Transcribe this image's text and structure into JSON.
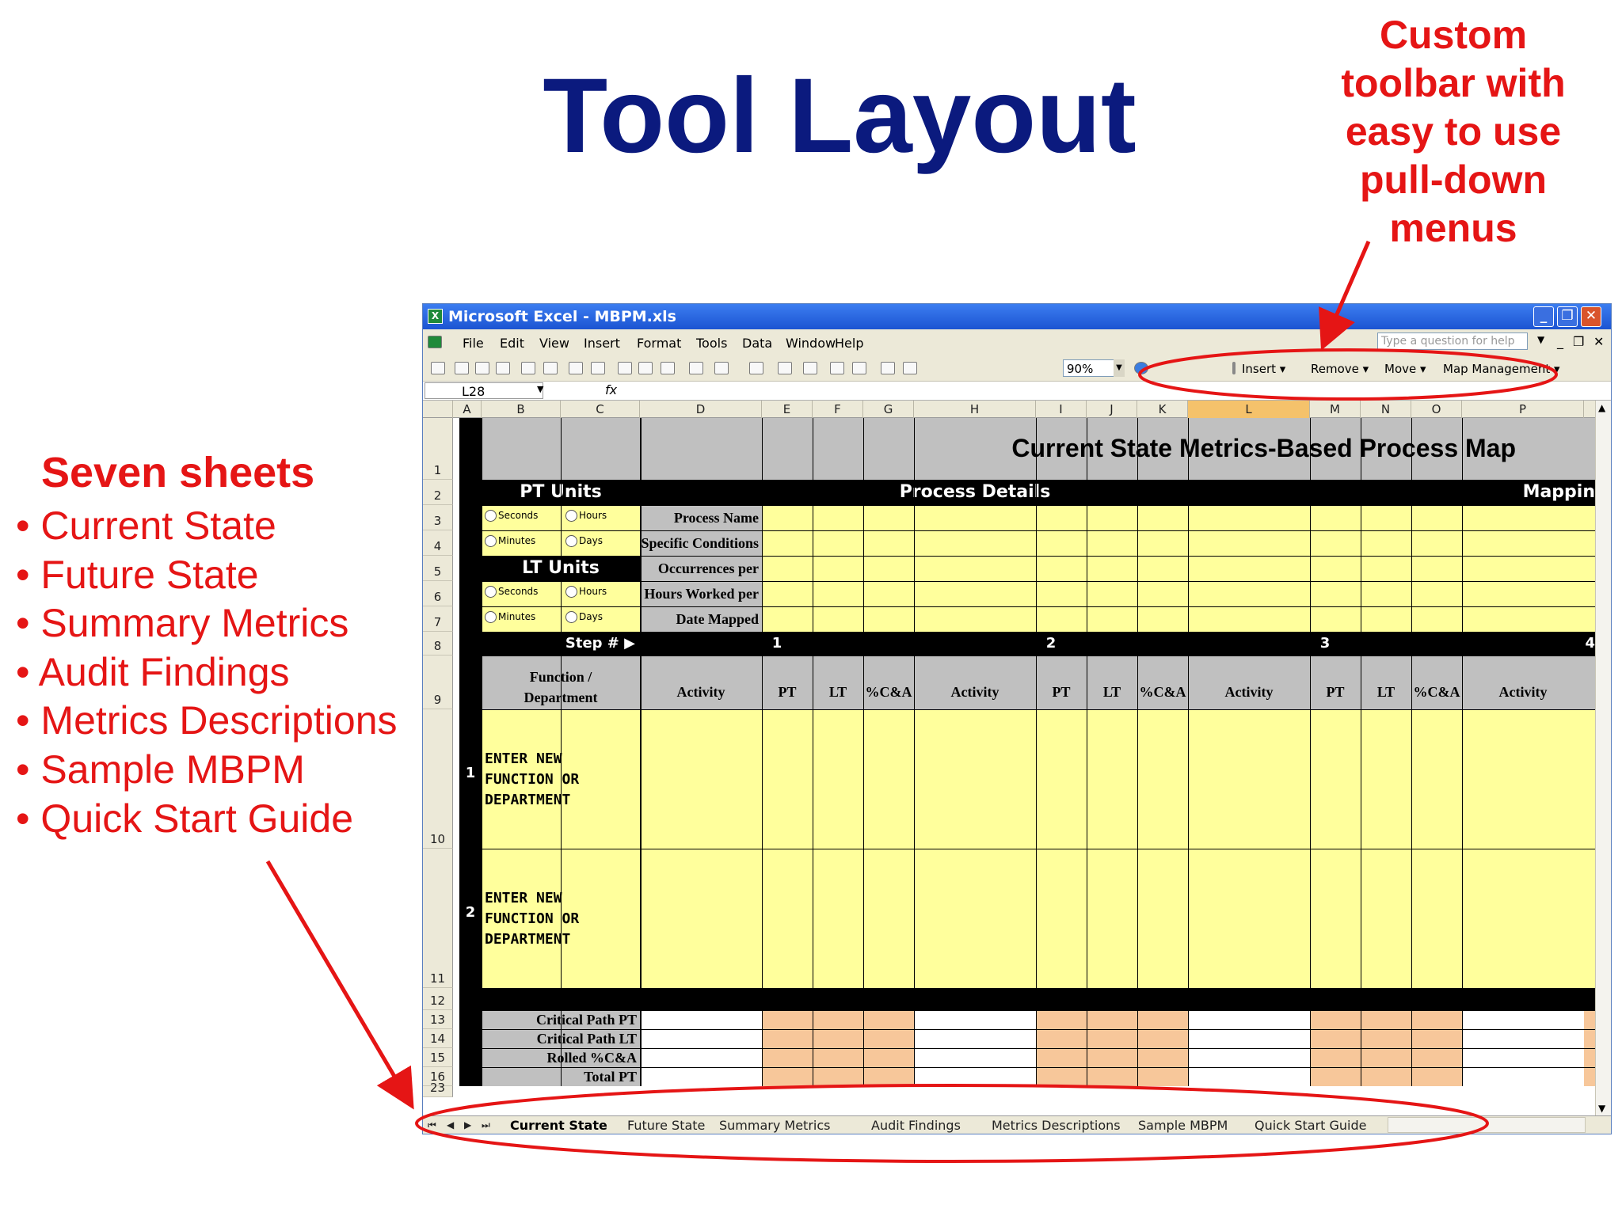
{
  "slide": {
    "title": "Tool Layout",
    "callout": "Custom toolbar with easy to use pull-down menus",
    "seven_sheets_title": "Seven sheets",
    "sheet_bullets": [
      "Current State",
      "Future State",
      "Summary Metrics",
      "Audit Findings",
      "Metrics Descriptions",
      "Sample MBPM",
      "Quick Start Guide"
    ],
    "bullet_char": "•",
    "annotation_color": "#e51515",
    "title_color": "#0b1a7e"
  },
  "excel": {
    "window_title": "Microsoft Excel - MBPM.xls",
    "app_icon": "X",
    "window_controls": {
      "minimize": "_",
      "restore": "❐",
      "close": "✕"
    },
    "mdi_controls": {
      "minimize": "_",
      "restore": "❐",
      "close": "✕"
    },
    "menus": [
      "File",
      "Edit",
      "View",
      "Insert",
      "Format",
      "Tools",
      "Data",
      "Window",
      "Help"
    ],
    "help_placeholder": "Type a question for help",
    "zoom": "90%",
    "custom_toolbar": [
      "Insert ▾",
      "Remove ▾",
      "Move ▾",
      "Map Management ▾"
    ],
    "name_box": "L28",
    "fx_label": "fx",
    "columns": [
      "A",
      "B",
      "C",
      "D",
      "E",
      "F",
      "G",
      "H",
      "I",
      "J",
      "K",
      "L",
      "M",
      "N",
      "O",
      "P"
    ],
    "selected_column": "L",
    "rows": [
      "1",
      "2",
      "3",
      "4",
      "5",
      "6",
      "7",
      "8",
      "9",
      "10",
      "11",
      "12",
      "13",
      "14",
      "15",
      "16",
      "23"
    ],
    "sheet_title": "Current State Metrics-Based Process Map",
    "pt_units": "PT Units",
    "lt_units": "LT Units",
    "unit_options": [
      "Seconds",
      "Hours",
      "Minutes",
      "Days"
    ],
    "process_details": "Process Details",
    "mapping_header": "Mappin",
    "detail_labels": [
      "Process Name",
      "Specific Conditions",
      "Occurrences per Year",
      "Hours Worked per Day",
      "Date Mapped"
    ],
    "step_label": "Step # ▶",
    "step_numbers": [
      "1",
      "2",
      "3",
      "4"
    ],
    "function_header": "Function / Department",
    "step_columns": [
      "Activity",
      "PT",
      "LT",
      "%C&A"
    ],
    "function_rows": [
      {
        "num": "1",
        "text": "ENTER NEW FUNCTION OR DEPARTMENT"
      },
      {
        "num": "2",
        "text": "ENTER NEW FUNCTION OR DEPARTMENT"
      }
    ],
    "summary_labels": [
      "Critical Path PT",
      "Critical Path LT",
      "Rolled %C&A",
      "Total PT"
    ],
    "sheet_tabs": [
      "Current State",
      "Future State",
      "Summary Metrics",
      "Audit Findings",
      "Metrics Descriptions",
      "Sample MBPM",
      "Quick Start Guide"
    ],
    "active_tab": "Current State",
    "tab_nav": [
      "⏮",
      "◀",
      "▶",
      "⏭"
    ]
  }
}
